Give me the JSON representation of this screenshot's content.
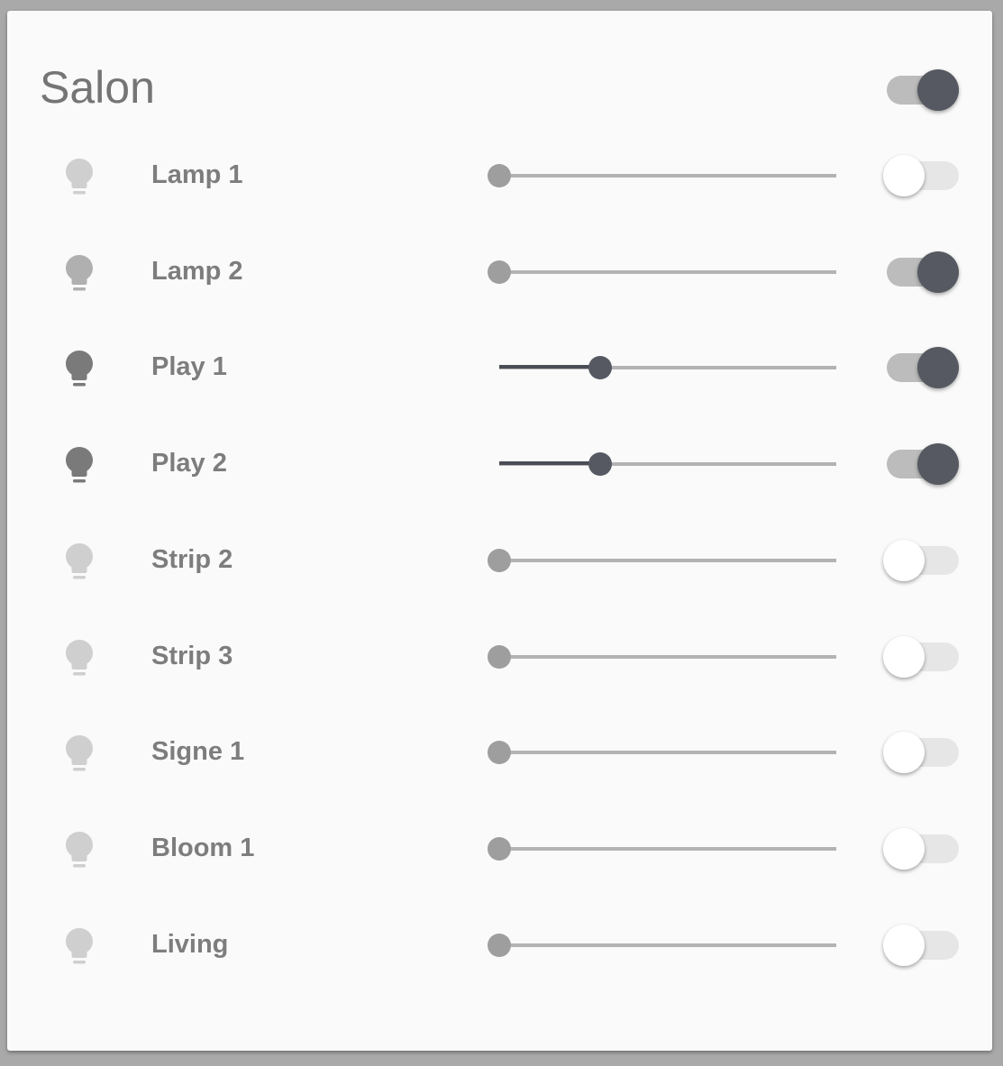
{
  "card": {
    "title": "Salon",
    "master_on": true
  },
  "colors": {
    "bulb_off": "#cfcfcf",
    "bulb_dim": "#b0b0b0",
    "bulb_on": "#7a7a7a",
    "knob_on": "#565961",
    "track_on": "#bcbcbc",
    "knob_off": "#ffffff",
    "track_off": "#e6e6e6"
  },
  "lights": [
    {
      "label": "Lamp 1",
      "brightness": 0,
      "on": false,
      "icon": "lightbulb-icon",
      "bulb_color": "#cfcfcf"
    },
    {
      "label": "Lamp 2",
      "brightness": 0,
      "on": true,
      "icon": "lightbulb-icon",
      "bulb_color": "#b0b0b0"
    },
    {
      "label": "Play 1",
      "brightness": 0.3,
      "on": true,
      "icon": "lightbulb-icon",
      "bulb_color": "#7a7a7a"
    },
    {
      "label": "Play 2",
      "brightness": 0.3,
      "on": true,
      "icon": "lightbulb-icon",
      "bulb_color": "#7a7a7a"
    },
    {
      "label": "Strip 2",
      "brightness": 0,
      "on": false,
      "icon": "lightbulb-icon",
      "bulb_color": "#cfcfcf"
    },
    {
      "label": "Strip 3",
      "brightness": 0,
      "on": false,
      "icon": "lightbulb-icon",
      "bulb_color": "#cfcfcf"
    },
    {
      "label": "Signe 1",
      "brightness": 0,
      "on": false,
      "icon": "lightbulb-icon",
      "bulb_color": "#cfcfcf"
    },
    {
      "label": "Bloom 1",
      "brightness": 0,
      "on": false,
      "icon": "lightbulb-icon",
      "bulb_color": "#cfcfcf"
    },
    {
      "label": "Living",
      "brightness": 0,
      "on": false,
      "icon": "lightbulb-icon",
      "bulb_color": "#cfcfcf"
    }
  ]
}
